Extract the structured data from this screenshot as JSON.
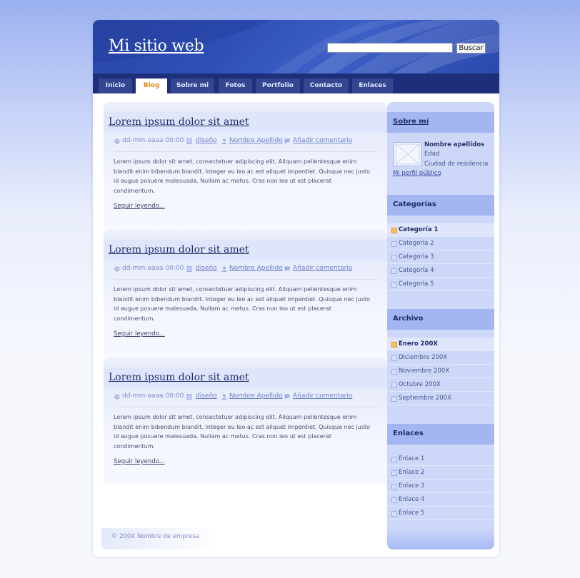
{
  "header": {
    "site_title": "Mi sitio web",
    "search_placeholder": "",
    "search_button": "Buscar"
  },
  "nav": {
    "items": [
      "Inicio",
      "Blog",
      "Sobre mi",
      "Fotos",
      "Portfolio",
      "Contacto",
      "Enlaces"
    ],
    "active": "Blog"
  },
  "posts": [
    {
      "title": "Lorem ipsum dolor sit amet",
      "date": "dd-mm-aaaa 00:00",
      "category": "diseño",
      "author": "Nombre Apellido",
      "comment": "Añadir comentario",
      "body": "Lorem ipsum dolor sit amet, consectetuer adipiscing elit. Aliquam pellentesque enim blandit enim bibendum blandit. Integer eu leo ac est aliquet imperdiet. Quisque nec justo id augue posuere malesuada. Nullam ac metus. Cras non leo ut est placerat condimentum.",
      "read_more": "Seguir leyendo..."
    },
    {
      "title": "Lorem ipsum dolor sit amet",
      "date": "dd-mm-aaaa 00:00",
      "category": "diseño",
      "author": "Nombre Apellido",
      "comment": "Añadir comentario",
      "body": "Lorem ipsum dolor sit amet, consectetuer adipiscing elit. Aliquam pellentesque enim blandit enim bibendum blandit. Integer eu leo ac est aliquet imperdiet. Quisque nec justo id augue posuere malesuada. Nullam ac metus. Cras non leo ut est placerat condimentum.",
      "read_more": "Seguir leyendo..."
    },
    {
      "title": "Lorem ipsum dolor sit amet",
      "date": "dd-mm-aaaa 00:00",
      "category": "diseño",
      "author": "Nombre Apellido",
      "comment": "Añadir comentario",
      "body": "Lorem ipsum dolor sit amet, consectetuer adipiscing elit. Aliquam pellentesque enim blandit enim bibendum blandit. Integer eu leo ac est aliquet imperdiet. Quisque nec justo id augue posuere malesuada. Nullam ac metus. Cras non leo ut est placerat condimentum.",
      "read_more": "Seguir leyendo..."
    }
  ],
  "sidebar": {
    "about": {
      "heading": "Sobre mí",
      "name": "Nombre apellidos",
      "age": "Edad",
      "city": "Ciudad de residencia",
      "profile_link": "Mi perfil público"
    },
    "categories": {
      "heading": "Categorías",
      "items": [
        "Categoría 1",
        "Categoría 2",
        "Categoría 3",
        "Categoría 4",
        "Categoría 5"
      ]
    },
    "archive": {
      "heading": "Archivo",
      "items": [
        "Enero 200X",
        "Diciembre 200X",
        "Noviembre 200X",
        "Octubre 200X",
        "Septiembre 200X"
      ]
    },
    "links": {
      "heading": "Enlaces",
      "items": [
        "Enlace 1",
        "Enlace 2",
        "Enlace 3",
        "Enlace 4",
        "Enlace 5"
      ]
    }
  },
  "footer": {
    "copyright": "© 200X Nombre de empresa"
  },
  "colors": {
    "header_blue": "#2f4fb5",
    "nav_dark": "#1d2e7a",
    "nav_active_text": "#e28a18",
    "sidebar_bg": "#cdd8f8",
    "sidebar_heading_bg": "#a3b6f2"
  }
}
